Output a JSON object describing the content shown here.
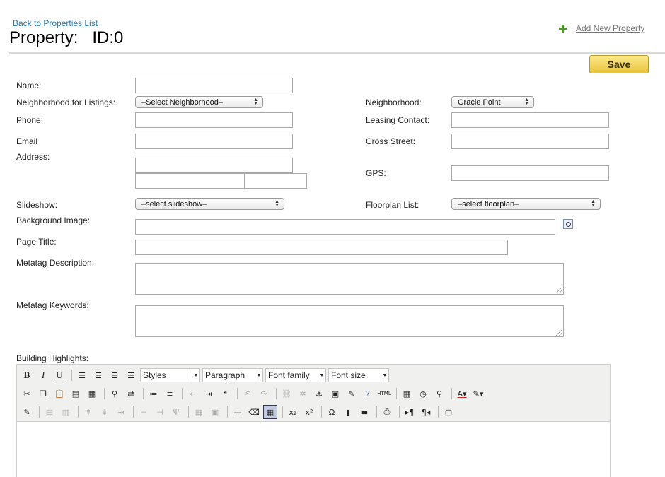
{
  "header": {
    "back_link": "Back to Properties List",
    "title": "Property:   ID:0",
    "add_new_property": "Add New Property",
    "save_label": "Save"
  },
  "form": {
    "name_label": "Name:",
    "neighborhood_listings_label": "Neighborhood for Listings:",
    "neighborhood_listings_value": "–Select Neighborhood–",
    "neighborhood_label": "Neighborhood:",
    "neighborhood_value": "Gracie Point",
    "phone_label": "Phone:",
    "leasing_contact_label": "Leasing Contact:",
    "email_label": "Email",
    "cross_street_label": "Cross Street:",
    "address_label": "Address:",
    "gps_label": "GPS:",
    "slideshow_label": "Slideshow:",
    "slideshow_value": "–select slideshow–",
    "floorplan_label": "Floorplan List:",
    "floorplan_value": "–select floorplan–",
    "background_image_label": "Background Image:",
    "page_title_label": "Page Title:",
    "meta_description_label": "Metatag Description:",
    "meta_keywords_label": "Metatag Keywords:",
    "building_highlights_label": "Building Highlights:"
  },
  "editor": {
    "styles": "Styles",
    "format": "Paragraph",
    "font_family": "Font family",
    "font_size": "Font size",
    "bold": "B",
    "italic": "I",
    "underline": "U",
    "html_label": "HTML"
  }
}
